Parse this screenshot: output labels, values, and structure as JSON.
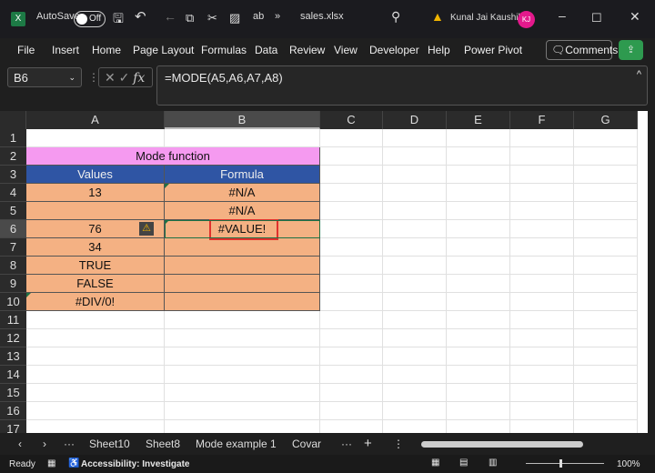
{
  "titlebar": {
    "autosave_label": "AutoSave",
    "autosave_state": "Off",
    "filename": "sales.xlsx",
    "user_name": "Kunal Jai Kaushik",
    "user_initials": "KJ",
    "overflow": "»"
  },
  "menu": [
    "File",
    "Insert",
    "Home",
    "Page Layout",
    "Formulas",
    "Data",
    "Review",
    "View",
    "Developer",
    "Help",
    "Power Pivot"
  ],
  "comments_label": "Comments",
  "formula_bar": {
    "name_box": "B6",
    "fx": "fx",
    "formula": "=MODE(A5,A6,A7,A8)"
  },
  "columns": [
    "A",
    "B",
    "C",
    "D",
    "E",
    "F",
    "G"
  ],
  "rows": [
    "1",
    "2",
    "3",
    "4",
    "5",
    "6",
    "7",
    "8",
    "9",
    "10",
    "11",
    "12",
    "13",
    "14",
    "15",
    "16",
    "17"
  ],
  "table": {
    "title": "Mode function",
    "headers": [
      "Values",
      "Formula"
    ],
    "rows": [
      [
        "13",
        "#N/A"
      ],
      [
        "",
        "#N/A"
      ],
      [
        "76",
        "#VALUE!"
      ],
      [
        "34",
        ""
      ],
      [
        "TRUE",
        ""
      ],
      [
        "FALSE",
        ""
      ],
      [
        "#DIV/0!",
        ""
      ]
    ],
    "colors": {
      "title_bg": "#f59af0",
      "header_bg": "#2f55a4",
      "body_bg": "#f4b183",
      "selection": "#e0312d"
    }
  },
  "sheet_tabs": [
    "Sheet10",
    "Sheet8",
    "Mode example 1",
    "Covar"
  ],
  "status": {
    "ready": "Ready",
    "accessibility": "Accessibility: Investigate",
    "zoom": "100%"
  }
}
